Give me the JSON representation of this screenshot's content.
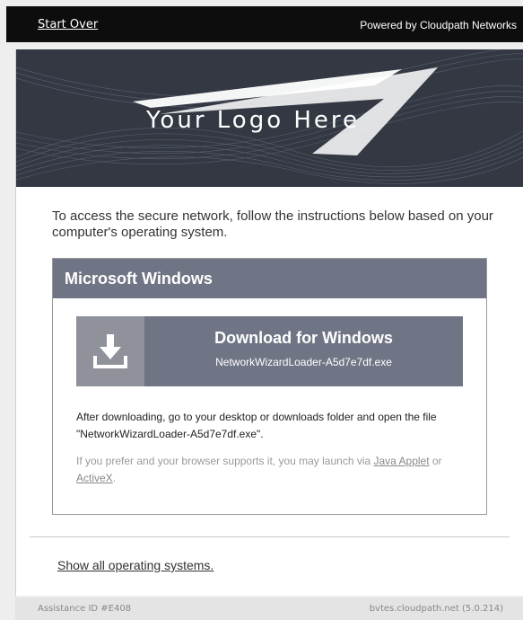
{
  "topbar": {
    "start_over": "Start Over",
    "powered_by": "Powered by Cloudpath Networks"
  },
  "banner": {
    "logo_text": "Your Logo Here"
  },
  "intro": "To access the secure network, follow the instructions below based on your computer's operating system.",
  "os_section": {
    "title": "Microsoft Windows",
    "download": {
      "icon": "download-icon",
      "label": "Download for Windows",
      "filename": "NetworkWizardLoader-A5d7e7df.exe"
    },
    "after_text": "After downloading, go to your desktop or downloads folder and open the file \"NetworkWizardLoader-A5d7e7df.exe\".",
    "alt_prefix": "If you prefer and your browser supports it, you may launch via ",
    "alt_link_java": "Java Applet",
    "alt_or": " or ",
    "alt_link_activex": "ActiveX",
    "alt_suffix": "."
  },
  "show_all": "Show all operating systems.",
  "footer": {
    "assistance_id": "Assistance ID #E408",
    "host_version": "bvtes.cloudpath.net (5.0.214)"
  },
  "colors": {
    "topbar": "#0d0d0d",
    "banner": "#333843",
    "accent": "#707585"
  }
}
